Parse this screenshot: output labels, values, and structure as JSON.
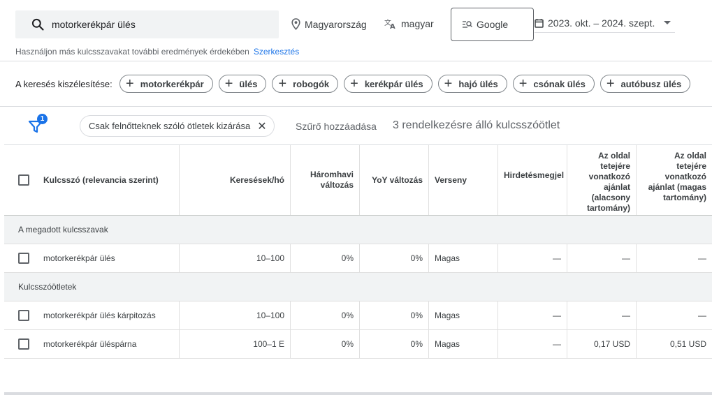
{
  "search": {
    "query": "motorkerékpár ülés"
  },
  "location": {
    "label": "Magyarország"
  },
  "language": {
    "label": "magyar"
  },
  "network": {
    "label": "Google"
  },
  "date_range": {
    "label": "2023. okt. – 2024. szept."
  },
  "hint": {
    "text": "Használjon más kulcsszavakat további eredmények érdekében",
    "link": "Szerkesztés"
  },
  "broaden": {
    "label": "A keresés kiszélesítése:",
    "chips": [
      "motorkerékpár",
      "ülés",
      "robogók",
      "kerékpár ülés",
      "hajó ülés",
      "csónak ülés",
      "autóbusz ülés"
    ]
  },
  "filters": {
    "badge_count": "1",
    "active_filter": "Csak felnőtteknek szóló ötletek kizárása",
    "add_filter": "Szűrő hozzáadása",
    "result_count": "3 rendelkezésre álló kulcsszóötlet"
  },
  "table": {
    "headers": {
      "keyword": "Kulcsszó (relevancia szerint)",
      "searches": "Keresések/hó",
      "three_month": "Háromhavi változás",
      "yoy": "YoY változás",
      "competition": "Verseny",
      "ad_impression": "Hirdetésmegjel",
      "top_bid_low": "Az oldal tetejére vonatkozó ajánlat (alacsony tartomány)",
      "top_bid_high": "Az oldal tetejére vonatkozó ajánlat (magas tartomány)"
    },
    "groups": {
      "provided": "A megadott kulcsszavak",
      "ideas": "Kulcsszóötletek"
    },
    "provided_rows": [
      {
        "keyword": "motorkerékpár ülés",
        "searches": "10–100",
        "three_month": "0%",
        "yoy": "0%",
        "competition": "Magas",
        "ad_impression": "—",
        "top_bid_low": "—",
        "top_bid_high": "—"
      }
    ],
    "idea_rows": [
      {
        "keyword": "motorkerékpár ülés kárpitozás",
        "searches": "10–100",
        "three_month": "0%",
        "yoy": "0%",
        "competition": "Magas",
        "ad_impression": "—",
        "top_bid_low": "—",
        "top_bid_high": "—"
      },
      {
        "keyword": "motorkerékpár üléspárna",
        "searches": "100–1 E",
        "three_month": "0%",
        "yoy": "0%",
        "competition": "Magas",
        "ad_impression": "—",
        "top_bid_low": "0,17 USD",
        "top_bid_high": "0,51 USD"
      }
    ]
  }
}
